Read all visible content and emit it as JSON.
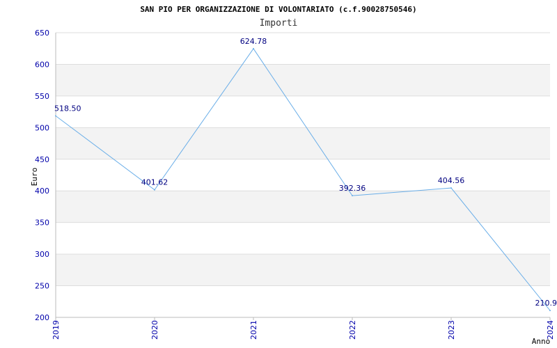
{
  "chart_data": {
    "type": "line",
    "title": "SAN PIO PER ORGANIZZAZIONE DI VOLONTARIATO (c.f.90028750546)",
    "subtitle": "Importi",
    "xlabel": "Anno",
    "ylabel": "Euro",
    "categories": [
      "2019",
      "2020",
      "2021",
      "2022",
      "2023",
      "2024"
    ],
    "values": [
      518.5,
      401.62,
      624.78,
      392.36,
      404.56,
      210.9
    ],
    "data_labels": [
      "518.50",
      "401.62",
      "624.78",
      "392.36",
      "404.56",
      "210.9"
    ],
    "ylim": [
      200,
      650
    ],
    "yticks": [
      200,
      250,
      300,
      350,
      400,
      450,
      500,
      550,
      600,
      650
    ],
    "grid": true,
    "line_color": "#6aaee8",
    "band_color": "#f3f3f3",
    "tick_color": "#0000aa",
    "label_color": "#000080"
  }
}
